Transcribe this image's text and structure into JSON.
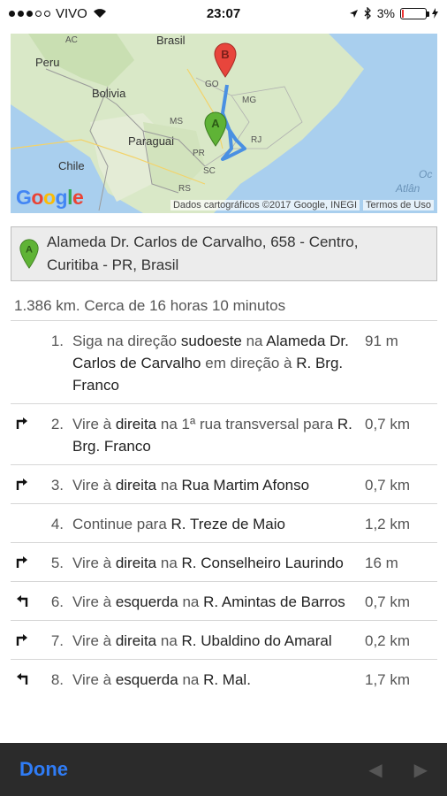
{
  "status": {
    "carrier": "VIVO",
    "time": "23:07",
    "battery": "3%"
  },
  "map": {
    "labels": {
      "ac": "AC",
      "brasil": "Brasil",
      "peru": "Peru",
      "bolivia": "Bolivia",
      "paraguai": "Paraguai",
      "chile": "Chile",
      "go": "GO",
      "mg": "MG",
      "ms": "MS",
      "sp": "SP",
      "pr": "PR",
      "rj": "RJ",
      "sc": "SC",
      "rs": "RS",
      "oc": "Oc",
      "atlan": "Atlân"
    },
    "google": "Google",
    "attribution": "Dados cartográficos ©2017 Google, INEGI",
    "terms": "Termos de Uso",
    "pin_a": "A",
    "pin_b": "B"
  },
  "address": {
    "pin": "A",
    "line1": "Alameda Dr. Carlos de Carvalho, 658 - Centro,",
    "line2": "Curitiba - PR, Brasil"
  },
  "summary": "1.386 km. Cerca de 16 horas 10 minutos",
  "steps": [
    {
      "num": "1.",
      "icon": "none",
      "distance": "91 m"
    },
    {
      "num": "2.",
      "icon": "turn-right-icon",
      "distance": "0,7 km"
    },
    {
      "num": "3.",
      "icon": "turn-right-icon",
      "distance": "0,7 km"
    },
    {
      "num": "4.",
      "icon": "none",
      "distance": "1,2 km"
    },
    {
      "num": "5.",
      "icon": "turn-right-icon",
      "distance": "16 m"
    },
    {
      "num": "6.",
      "icon": "turn-left-icon",
      "distance": "0,7 km"
    },
    {
      "num": "7.",
      "icon": "turn-right-icon",
      "distance": "0,2 km"
    },
    {
      "num": "8.",
      "icon": "turn-left-icon",
      "distance": "1,7 km"
    }
  ],
  "step_texts": {
    "s1a": "Siga na direção ",
    "s1b": "sudoeste",
    "s1c": " na ",
    "s1d": "Alameda Dr. Carlos de Carvalho",
    "s1e": " em direção à ",
    "s1f": "R. Brg. Franco",
    "s2a": "Vire à ",
    "s2b": "direita",
    "s2c": " na 1ª rua transversal para ",
    "s2d": "R. Brg. Franco",
    "s3a": "Vire à ",
    "s3b": "direita",
    "s3c": " na ",
    "s3d": "Rua Martim Afonso",
    "s4a": "Continue para ",
    "s4b": "R. Treze de Maio",
    "s5a": "Vire à ",
    "s5b": "direita",
    "s5c": " na ",
    "s5d": "R. Conselheiro Laurindo",
    "s6a": "Vire à ",
    "s6b": "esquerda",
    "s6c": " na ",
    "s6d": "R. Amintas de Barros",
    "s7a": "Vire à ",
    "s7b": "direita",
    "s7c": " na ",
    "s7d": "R. Ubaldino do Amaral",
    "s8a": "Vire à ",
    "s8b": "esquerda",
    "s8c": " na ",
    "s8d": "R. Mal."
  },
  "toolbar": {
    "done": "Done"
  },
  "colors": {
    "done_blue": "#2f7cf6",
    "route_blue": "#4a90e2",
    "pin_a_green": "#5fb336",
    "pin_b_red": "#e8453c"
  }
}
